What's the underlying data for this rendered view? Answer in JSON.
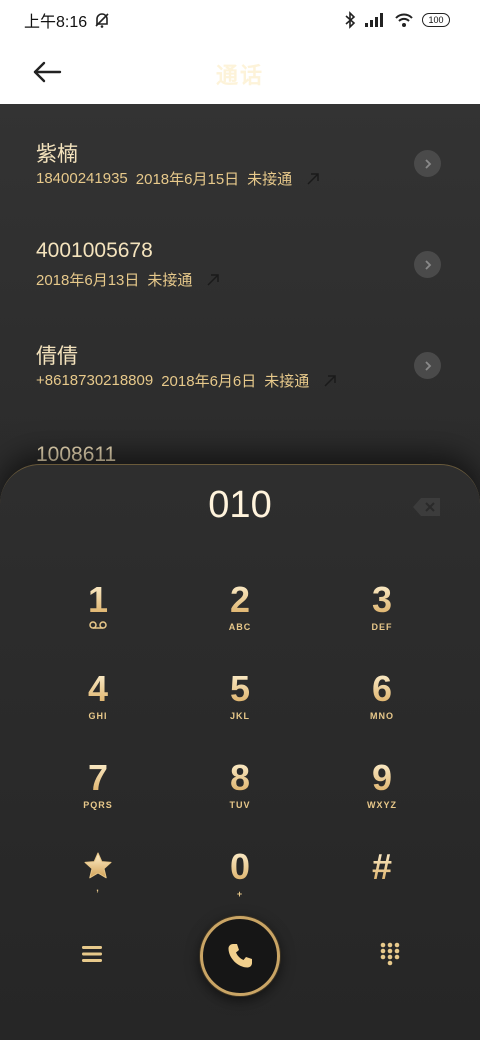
{
  "status_bar": {
    "time": "上午8:16",
    "battery": "100"
  },
  "header": {
    "title": "通话"
  },
  "calls": [
    {
      "name": "紫楠",
      "number": "18400241935",
      "date": "2018年6月15日",
      "status": "未接通"
    },
    {
      "name": "4001005678",
      "number": "",
      "date": "2018年6月13日",
      "status": "未接通"
    },
    {
      "name": "倩倩",
      "number": "+8618730218809",
      "date": "2018年6月6日",
      "status": "未接通"
    },
    {
      "name": "1008611",
      "number": "",
      "date": "",
      "status": ""
    }
  ],
  "dialpad": {
    "input": "010",
    "keys": [
      {
        "digit": "1",
        "letters": ""
      },
      {
        "digit": "2",
        "letters": "ABC"
      },
      {
        "digit": "3",
        "letters": "DEF"
      },
      {
        "digit": "4",
        "letters": "GHI"
      },
      {
        "digit": "5",
        "letters": "JKL"
      },
      {
        "digit": "6",
        "letters": "MNO"
      },
      {
        "digit": "7",
        "letters": "PQRS"
      },
      {
        "digit": "8",
        "letters": "TUV"
      },
      {
        "digit": "9",
        "letters": "WXYZ"
      },
      {
        "digit": "",
        "letters": ","
      },
      {
        "digit": "0",
        "letters": "+"
      },
      {
        "digit": "#",
        "letters": ""
      }
    ]
  },
  "colors": {
    "gold": "#e7c98b",
    "panel": "#2a2a2a",
    "title_cream": "#fdf3d9"
  }
}
